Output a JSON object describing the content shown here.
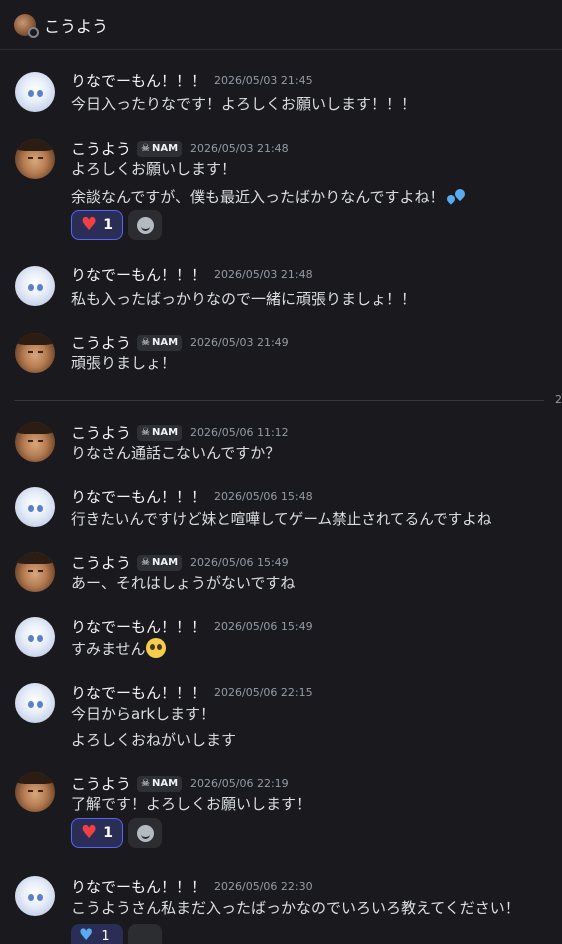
{
  "channel": {
    "title": "こうよう"
  },
  "tag_label": "NAM",
  "divider_label": "2",
  "messages": [
    {
      "author": "りなでーもん！！！",
      "time": "2026/05/03 21:45",
      "lines": [
        "今日入ったりなです！よろしくお願いします！！！"
      ]
    },
    {
      "author": "こうよう",
      "time": "2026/05/03 21:48",
      "lines": [
        "よろしくお願いします！",
        "余談なんですが、僕も最近入ったばかりなんですよね！"
      ],
      "reaction_count": "1"
    },
    {
      "author": "りなでーもん！！！",
      "time": "2026/05/03 21:48",
      "lines": [
        "私も入ったばっかりなので一緒に頑張りましょ！！"
      ]
    },
    {
      "author": "こうよう",
      "time": "2026/05/03 21:49",
      "lines": [
        "頑張りましょ！"
      ]
    },
    {
      "author": "こうよう",
      "time": "2026/05/06 11:12",
      "lines": [
        "りなさん通話こないんですか？"
      ]
    },
    {
      "author": "りなでーもん！！！",
      "time": "2026/05/06 15:48",
      "lines": [
        "行きたいんですけど妹と喧嘩してゲーム禁止されてるんですよね"
      ]
    },
    {
      "author": "こうよう",
      "time": "2026/05/06 15:49",
      "lines": [
        "あー、それはしょうがないですね"
      ]
    },
    {
      "author": "りなでーもん！！！",
      "time": "2026/05/06 15:49",
      "lines": [
        "すみません"
      ]
    },
    {
      "author": "りなでーもん！！！",
      "time": "2026/05/06 22:15",
      "lines": [
        "今日からarkします！",
        "よろしくおねがいします"
      ]
    },
    {
      "author": "こうよう",
      "time": "2026/05/06 22:19",
      "lines": [
        "了解です！よろしくお願いします！"
      ],
      "reaction_count": "1"
    },
    {
      "author": "りなでーもん！！！",
      "time": "2026/05/06 22:30",
      "lines": [
        "こうようさん私まだ入ったばっかなのでいろいろ教えてください！"
      ],
      "reaction_count": "1"
    }
  ],
  "icons": [
    "skull-icon",
    "heart-icon",
    "add-reaction-icon",
    "sweat-drops-emoji",
    "pleading-face-emoji"
  ],
  "colors": {
    "background": "#1a1a1e",
    "accent": "#5865f2",
    "heart": "#f23f43"
  }
}
